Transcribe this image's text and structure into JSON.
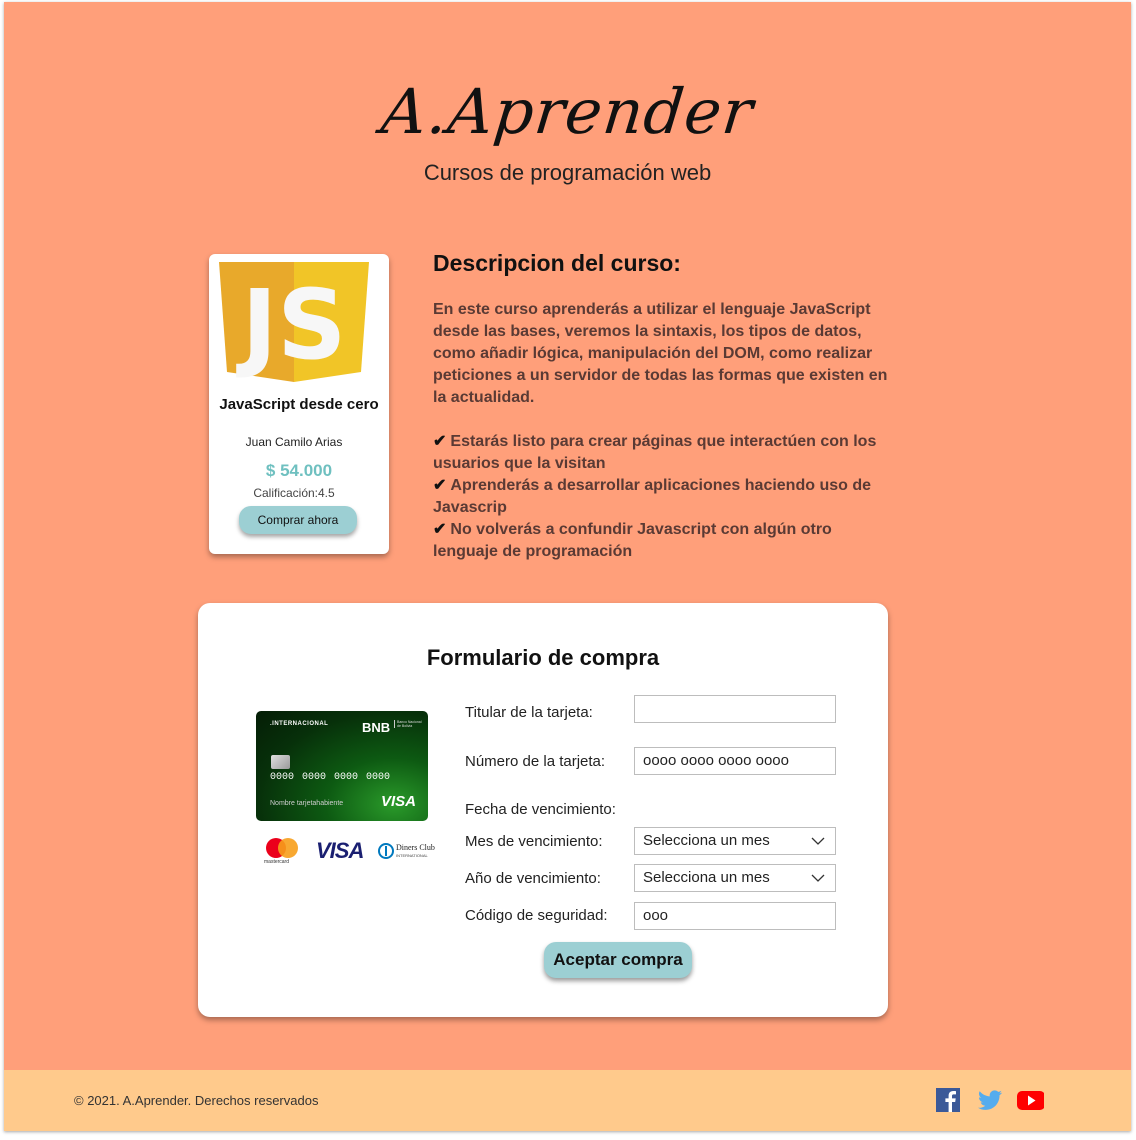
{
  "header": {
    "logo_text": "A.Aprender",
    "tagline": "Cursos de programación web"
  },
  "course_card": {
    "title": "JavaScript desde cero",
    "author": "Juan Camilo Arias",
    "price": "$ 54.000",
    "rating": "Calificación:4.5",
    "buy_label": "Comprar ahora",
    "logo_text": "JS",
    "logo_colors": {
      "left": "#e8a92b",
      "right": "#f1c527",
      "letters": "#ffffff"
    }
  },
  "description": {
    "heading": "Descripcion del curso:",
    "body": "En este curso aprenderás a utilizar el lenguaje JavaScript desde las bases, veremos la sintaxis, los tipos de datos, como añadir lógica, manipulación del DOM, como realizar peticiones a un servidor de todas las formas que existen en la actualidad.",
    "benefits": [
      {
        "check": "✔",
        "text": "Estarás listo para crear páginas que interactúen con los usuarios que la visitan"
      },
      {
        "check": "✔",
        "text": "Aprenderás a desarrollar aplicaciones haciendo uso de Javascrip"
      },
      {
        "check": "✔",
        "text": "No volverás a confundir Javascript con algún otro lenguaje de programación"
      }
    ]
  },
  "form": {
    "title": "Formulario de compra",
    "card_image": {
      "label": ".INTERNACIONAL",
      "bank": "BNB",
      "bank_full": "Banco Nacional de Bolivia",
      "number": "0000 0000 0000 0000",
      "holder": "Nombre tarjetahabiente",
      "network": "VISA"
    },
    "brands": {
      "mastercard": "mastercard",
      "visa": "VISA",
      "diners": "Diners Club",
      "diners_sub": "INTERNATIONAL"
    },
    "fields": {
      "holder_label": "Titular de la tarjeta:",
      "holder_value": "",
      "number_label": "Número de la tarjeta:",
      "number_value": "oooo oooo oooo oooo",
      "expiry_heading": "Fecha de vencimiento:",
      "month_label": "Mes de vencimiento:",
      "month_value": "Selecciona un mes",
      "year_label": "Año de vencimiento:",
      "year_value": "Selecciona un mes",
      "cvv_label": "Código de seguridad:",
      "cvv_value": "ooo"
    },
    "submit_label": "Aceptar compra"
  },
  "footer": {
    "copyright": "© 2021. A.Aprender. Derechos reservados",
    "social": [
      {
        "icon": "facebook-icon",
        "color": "#3b5998"
      },
      {
        "icon": "twitter-icon",
        "color": "#55acee"
      },
      {
        "icon": "youtube-icon",
        "color": "#ff0000"
      }
    ]
  },
  "colors": {
    "page_bg": "#ff9f7a",
    "footer_bg": "#ffca8c",
    "button_bg": "#9ccfd3",
    "price": "#6fc0c0",
    "description_text": "#5a3a34"
  }
}
